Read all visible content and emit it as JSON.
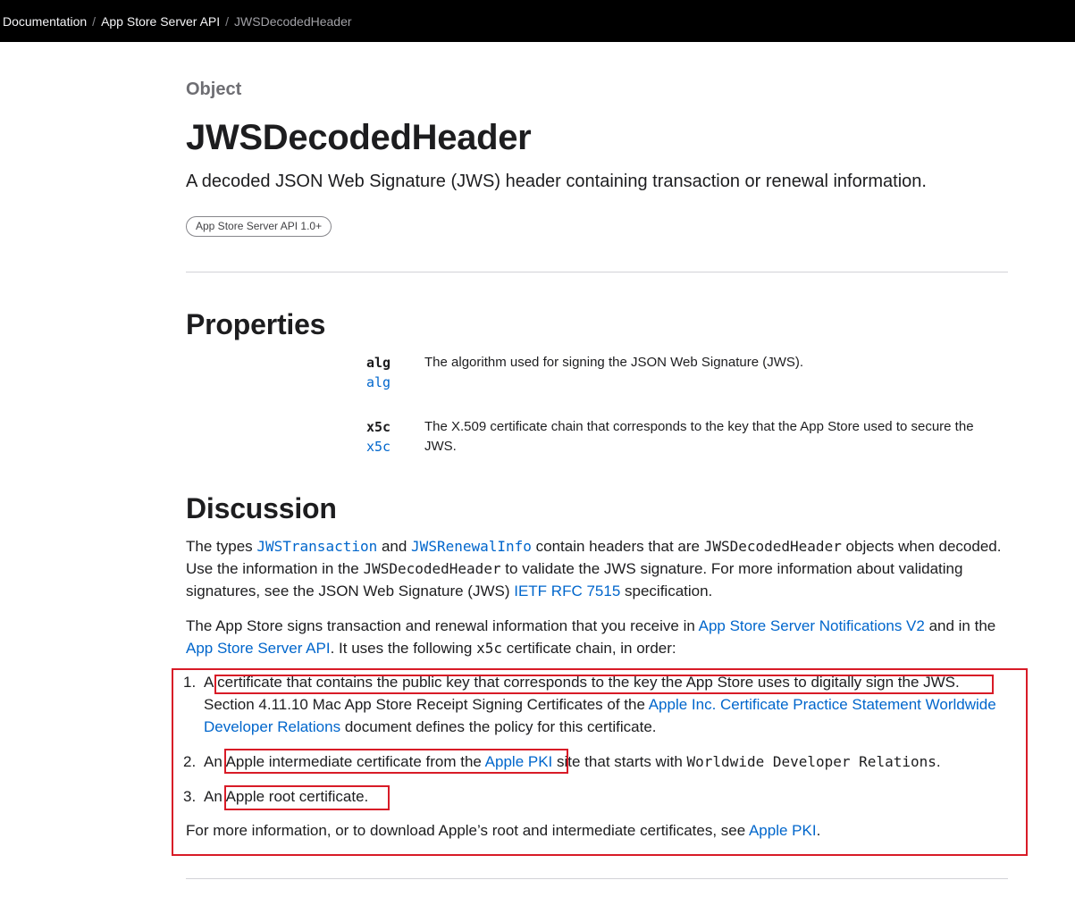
{
  "breadcrumb": {
    "items": [
      "Documentation",
      "App Store Server API"
    ],
    "current": "JWSDecodedHeader",
    "separator": "/"
  },
  "header": {
    "eyebrow": "Object",
    "title": "JWSDecodedHeader",
    "abstract": "A decoded JSON Web Signature (JWS) header containing transaction or renewal information.",
    "availability_badge": "App Store Server API 1.0+"
  },
  "properties": {
    "heading": "Properties",
    "items": [
      {
        "name": "alg",
        "type": "alg",
        "description": "The algorithm used for signing the JSON Web Signature (JWS)."
      },
      {
        "name": "x5c",
        "type": "x5c",
        "description": "The X.509 certificate chain that corresponds to the key that the App Store used to secure the JWS."
      }
    ]
  },
  "discussion": {
    "heading": "Discussion",
    "p1": {
      "t1": "The types ",
      "link1": "JWSTransaction",
      "t2": " and ",
      "link2": "JWSRenewalInfo",
      "t3": " contain headers that are ",
      "code1": "JWSDecodedHeader",
      "t4": " objects when decoded. Use the information in the ",
      "code2": "JWSDecodedHeader",
      "t5": " to validate the JWS signature. For more information about validating signatures, see the JSON Web Signature (JWS) ",
      "link3": "IETF RFC 7515",
      "t6": " specification."
    },
    "p2": {
      "t1": "The App Store signs transaction and renewal information that you receive in ",
      "link1": "App Store Server Notifications V2",
      "t2": " and in the ",
      "link2": "App Store Server API",
      "t3": ". It uses the following ",
      "code1": "x5c",
      "t4": " certificate chain, in order:"
    },
    "list": [
      {
        "num": "1.",
        "t1": "A certificate that contains the public key that corresponds to the key the App Store uses to digitally sign the JWS. Section 4.11.10 Mac App Store Receipt Signing Certificates of the ",
        "link1": "Apple Inc. Certificate Practice Statement Worldwide Developer Relations",
        "t2": " document defines the policy for this certificate."
      },
      {
        "num": "2.",
        "t1": "An Apple intermediate certificate from the ",
        "link1": "Apple PKI",
        "t2": " site that starts with ",
        "code1": "Worldwide Developer Relations",
        "t3": "."
      },
      {
        "num": "3.",
        "t1": "An Apple root certificate."
      }
    ],
    "p3": {
      "t1": "For more information, or to download Apple’s root and intermediate certificates, see ",
      "link1": "Apple PKI",
      "t2": "."
    }
  },
  "colors": {
    "topbar": "#000000",
    "link": "#0066cc",
    "highlight": "#d81b27"
  }
}
